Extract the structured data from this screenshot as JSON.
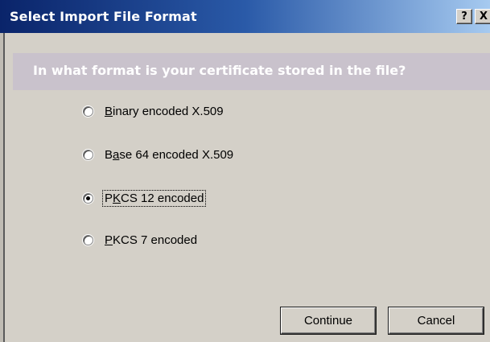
{
  "window": {
    "title": "Select Import File Format",
    "help_glyph": "?",
    "close_glyph": "X"
  },
  "banner": {
    "question": "In what format is your certificate stored in the file?"
  },
  "options": [
    {
      "pre": "",
      "accel": "B",
      "post": "inary encoded X.509",
      "checked": false
    },
    {
      "pre": "B",
      "accel": "a",
      "post": "se 64 encoded X.509",
      "checked": false
    },
    {
      "pre": "P",
      "accel": "K",
      "post": "CS 12 encoded",
      "checked": true
    },
    {
      "pre": "",
      "accel": "P",
      "post": "KCS 7 encoded",
      "checked": false
    }
  ],
  "buttons": {
    "continue_label": "Continue",
    "cancel_label": "Cancel"
  },
  "colors": {
    "title_start": "#0a246a",
    "title_end": "#a6caf0",
    "dialog_bg": "#d4d0c8",
    "banner_bg": "#c9c2cc"
  }
}
